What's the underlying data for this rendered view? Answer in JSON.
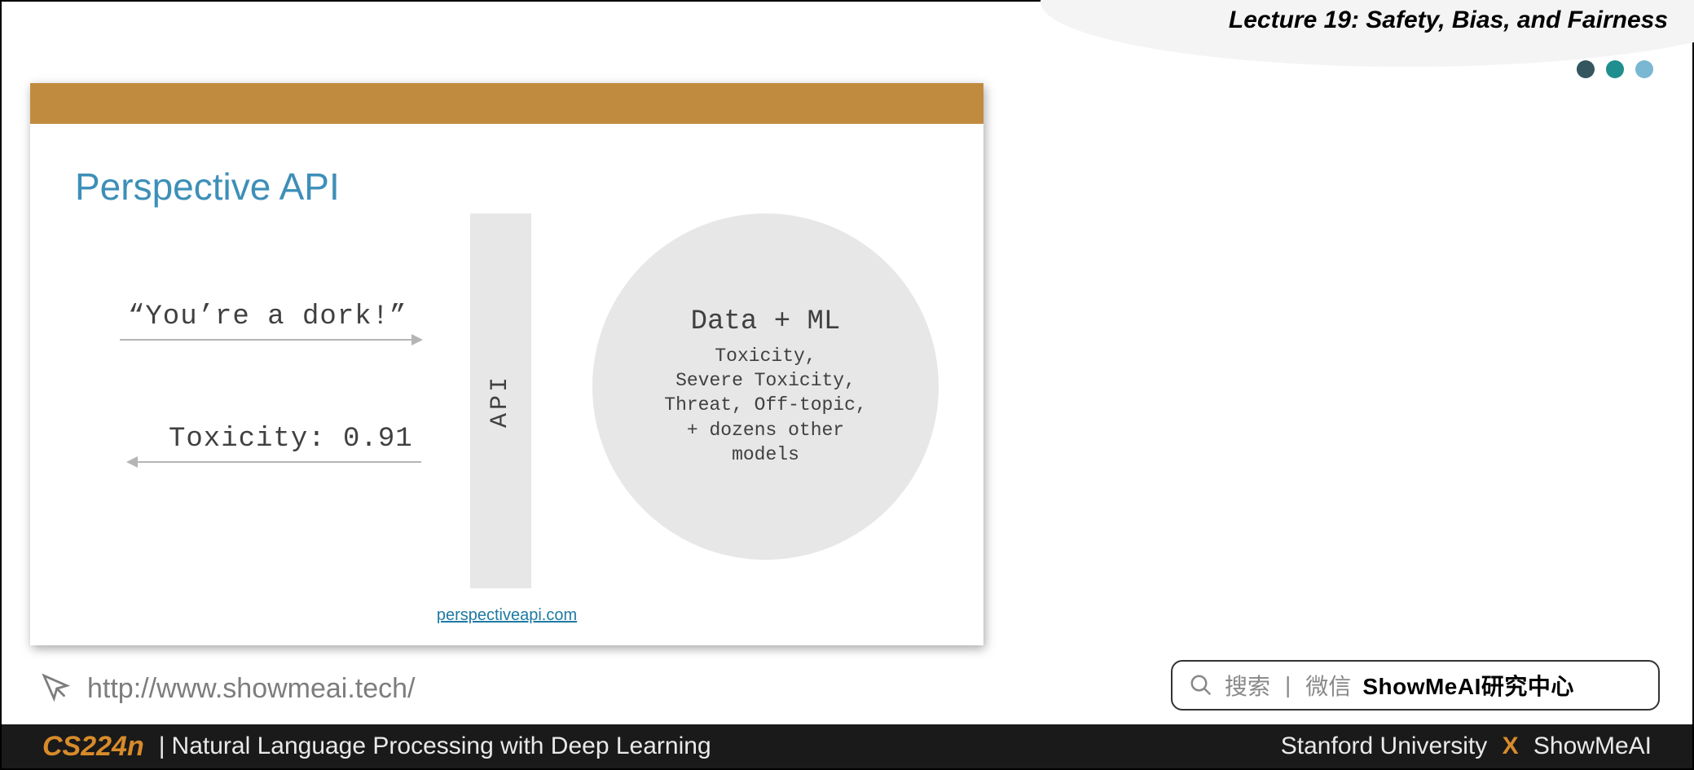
{
  "header": {
    "lecture_title": "Lecture 19: Safety, Bias, and Fairness"
  },
  "slide": {
    "title": "Perspective API",
    "input_example": "“You’re a dork!”",
    "output_example": "Toxicity: 0.91",
    "api_box_label": "API",
    "ml_title": "Data + ML",
    "ml_lines": "Toxicity,\nSevere Toxicity,\nThreat, Off-topic,\n+ dozens other\nmodels",
    "source_url": "perspectiveapi.com"
  },
  "link_row": {
    "url": "http://www.showmeai.tech/"
  },
  "search": {
    "hint1": "搜索",
    "hint2": "微信",
    "brand": "ShowMeAI研究中心"
  },
  "footer": {
    "course_code": "CS224n",
    "course_name": "Natural Language Processing with Deep Learning",
    "org": "Stanford University",
    "partner": "ShowMeAI"
  }
}
